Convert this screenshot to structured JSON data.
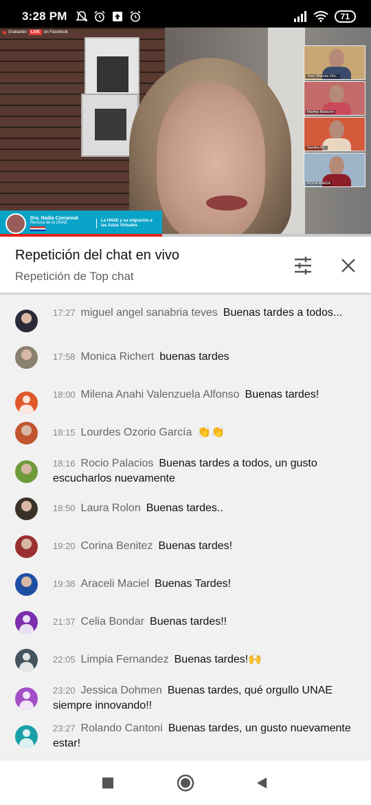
{
  "status_bar": {
    "time": "3:28 PM",
    "battery": "71",
    "icons": [
      "do-not-disturb-icon",
      "alarm-icon",
      "upload-icon",
      "alarm-icon",
      "signal-icon",
      "wifi-icon",
      "battery-icon"
    ]
  },
  "video": {
    "live_badge_prefix": "Grabando",
    "live_label": "LIVE",
    "live_badge_suffix": "en Facebook",
    "participants": [
      {
        "name": "Jose Marcos Ovi...",
        "bg": "#c9a774",
        "shirt": "#3b4a6b"
      },
      {
        "name": "Martha Malache",
        "bg": "#c46a6a",
        "shirt": "#c94a5a"
      },
      {
        "name": "Sandra M...",
        "bg": "#d55a3c",
        "shirt": "#e8d6c0"
      },
      {
        "name": "ROSA MARIA",
        "bg": "#9eb4c9",
        "shirt": "#8c1e2a"
      }
    ],
    "speaker_name": "Dra. Nadia Czeraniuk",
    "speaker_role": "Rectora de la UNAE",
    "topic": "La UNAE y su migración a las Aulas Virtuales",
    "progress_fraction": 0.437
  },
  "chat": {
    "title": "Repetición del chat en vivo",
    "subtitle": "Repetición de Top chat",
    "messages": [
      {
        "time": "17:27",
        "author": "miguel angel sanabria teves",
        "text": "Buenas tardes a todos...",
        "avatar": "photo",
        "color": "#2a2a38"
      },
      {
        "time": "17:58",
        "author": "Monica Richert",
        "text": "buenas tardes",
        "avatar": "photo",
        "color": "#8a8070"
      },
      {
        "time": "18:00",
        "author": "Milena Anahi Valenzuela Alfonso",
        "text": "Buenas tardes!",
        "avatar": "generic",
        "color": "#e0592a"
      },
      {
        "time": "18:15",
        "author": "Lourdes Ozorio García",
        "text": "👏👏",
        "avatar": "photo",
        "color": "#c2542e"
      },
      {
        "time": "18:16",
        "author": "Rocio Palacios",
        "text": "Buenas tardes a todos, un gusto escucharlos nuevamente",
        "avatar": "photo",
        "color": "#6f9a3c"
      },
      {
        "time": "18:50",
        "author": "Laura Rolon",
        "text": "Buenas tardes..",
        "avatar": "photo",
        "color": "#3a3128"
      },
      {
        "time": "19:20",
        "author": "Corina Benitez",
        "text": "Buenas tardes!",
        "avatar": "photo",
        "color": "#9a3030"
      },
      {
        "time": "19:38",
        "author": "Araceli Maciel",
        "text": "Buenas Tardes!",
        "avatar": "photo",
        "color": "#1e4fa3"
      },
      {
        "time": "21:37",
        "author": "Celia Bondar",
        "text": "Buenas tardes!!",
        "avatar": "generic",
        "color": "#7b2fae"
      },
      {
        "time": "22:05",
        "author": "Limpia Fernandez",
        "text": "Buenas tardes!🙌",
        "avatar": "generic",
        "color": "#44555e"
      },
      {
        "time": "23:20",
        "author": "Jessica Dohmen",
        "text": "Buenas tardes, qué orgullo UNAE siempre innovando!!",
        "avatar": "generic",
        "color": "#a24fc7"
      },
      {
        "time": "23:27",
        "author": "Rolando Cantoni",
        "text": "Buenas tardes, un gusto nuevamente estar!",
        "avatar": "generic",
        "color": "#1aa0a8"
      }
    ]
  },
  "nav": {
    "icons": [
      "recents-square-icon",
      "home-circle-icon",
      "back-triangle-icon"
    ]
  }
}
